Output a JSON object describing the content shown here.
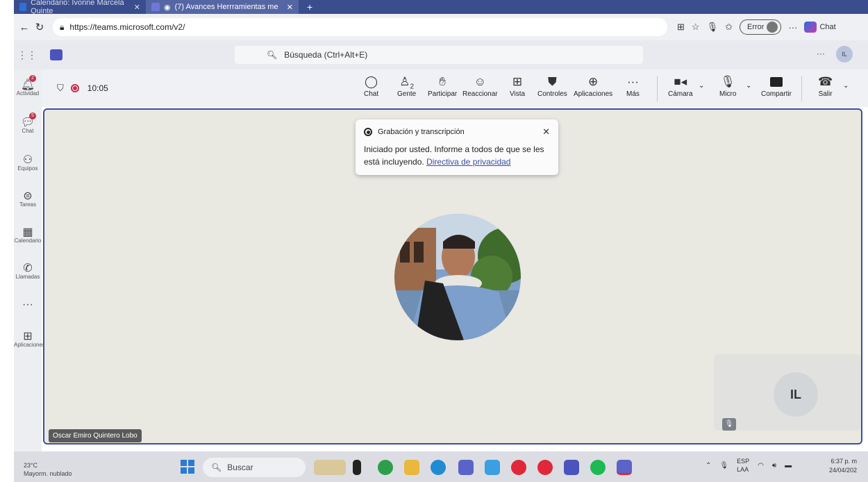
{
  "browser": {
    "tabs": [
      {
        "label": "Calendario: Ivonne Marcela Quinte",
        "active": false
      },
      {
        "label": "(7) Avances Herrramientas me",
        "active": true
      }
    ],
    "new_tab": "+",
    "url": "https://teams.microsoft.com/v2/",
    "error_label": "Error",
    "copilot_label": "Chat",
    "more": "···"
  },
  "teams_header": {
    "search_placeholder": "Búsqueda (Ctrl+Alt+E)",
    "more": "···",
    "avatar_initials": "IL"
  },
  "rail": {
    "items": [
      {
        "label": "Actividad",
        "icon": "bell-icon",
        "badge": "2"
      },
      {
        "label": "Chat",
        "icon": "chat-icon",
        "badge": "5"
      },
      {
        "label": "Equipos",
        "icon": "teams-icon"
      },
      {
        "label": "Tareas",
        "icon": "tasks-icon"
      },
      {
        "label": "Calendario",
        "icon": "calendar-icon"
      },
      {
        "label": "Llamadas",
        "icon": "phone-icon"
      },
      {
        "label": "···",
        "icon": "more-icon"
      },
      {
        "label": "Aplicaciones",
        "icon": "add-apps-icon"
      }
    ]
  },
  "meeting": {
    "timer": "10:05",
    "toolbar": {
      "chat": "Chat",
      "people": "Gente",
      "people_count": "2",
      "raise": "Participar",
      "react": "Reaccionar",
      "view": "Vista",
      "controls": "Controles",
      "apps": "Aplicaciones",
      "more": "Más",
      "camera": "Cámara",
      "mic": "Micro",
      "share": "Compartir",
      "leave": "Salir"
    },
    "toast": {
      "title": "Grabación y transcripción",
      "body": "Iniciado por usted. Informe a todos de que se les está incluyendo.",
      "link": "Directiva de privacidad"
    },
    "participant_name": "Oscar Emiro Quintero Lobo",
    "self_initials": "IL"
  },
  "taskbar": {
    "weather_temp": "23°C",
    "weather_desc": "Mayorm. nublado",
    "search": "Buscar",
    "lang_top": "ESP",
    "lang_bottom": "LAA",
    "time": "6:37 p. m",
    "date": "24/04/202"
  },
  "colors": {
    "accent": "#3a4fa0",
    "record": "#c4314b",
    "stage_bg": "#e9e8e1"
  }
}
